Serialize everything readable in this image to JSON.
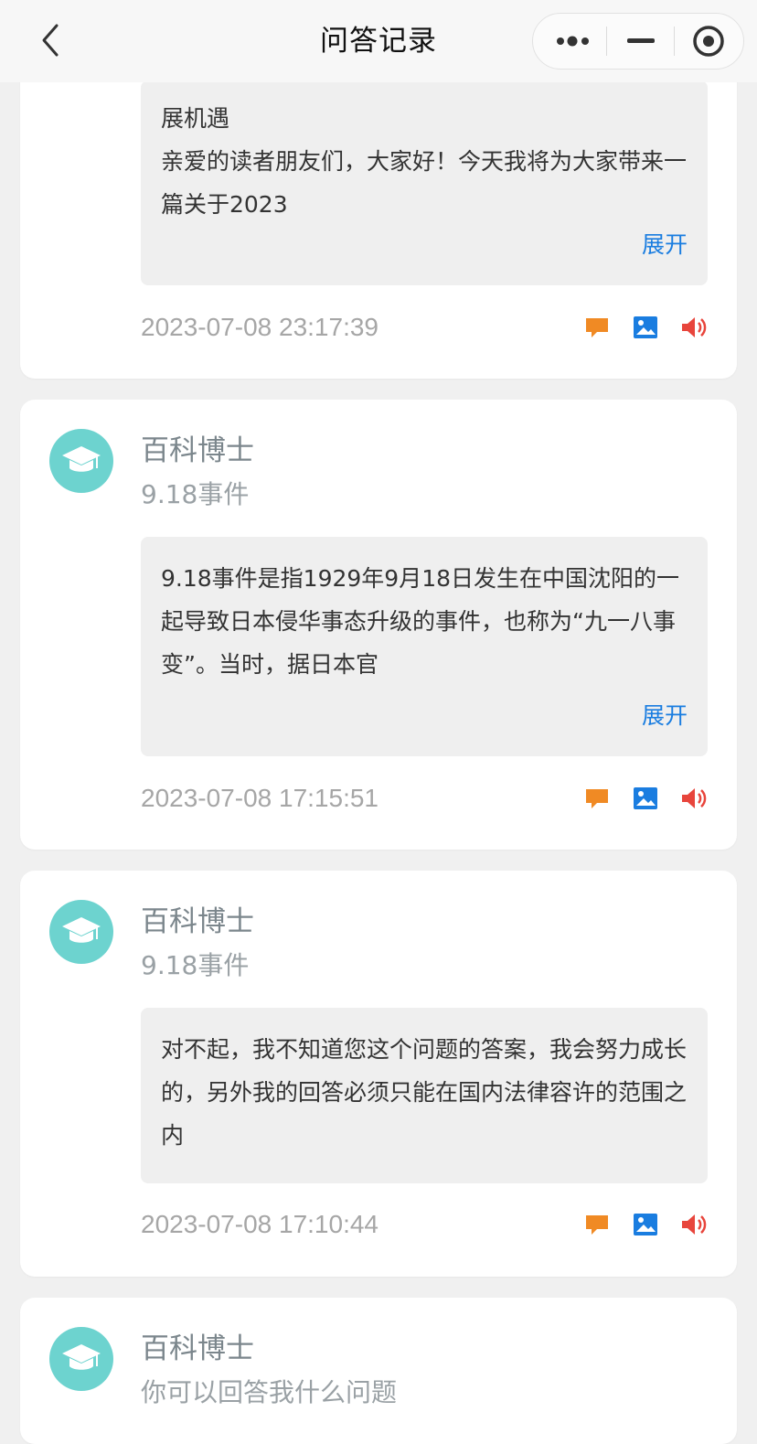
{
  "nav": {
    "title": "问答记录"
  },
  "cards": [
    {
      "answer": "展机遇\n亲爱的读者朋友们，大家好！今天我将为大家带来一篇关于2023",
      "expand": "展开",
      "time": "2023-07-08 23:17:39"
    },
    {
      "bot_name": "百科博士",
      "question": "9.18事件",
      "answer": "9.18事件是指1929年9月18日发生在中国沈阳的一起导致日本侵华事态升级的事件，也称为“九一八事变”。当时，据日本官",
      "expand": "展开",
      "time": "2023-07-08 17:15:51"
    },
    {
      "bot_name": "百科博士",
      "question": "9.18事件",
      "answer": "对不起，我不知道您这个问题的答案，我会努力成长的，另外我的回答必须只能在国内法律容许的范围之内",
      "time": "2023-07-08 17:10:44"
    },
    {
      "bot_name": "百科博士",
      "question": "你可以回答我什么问题"
    }
  ],
  "icons": [
    "chat-icon",
    "image-icon",
    "speaker-icon"
  ],
  "colors": {
    "chat": "#f08a24",
    "image": "#1a7de0",
    "speaker": "#e8453c",
    "avatar": "#6dd3cf",
    "expand": "#1a7de0"
  }
}
